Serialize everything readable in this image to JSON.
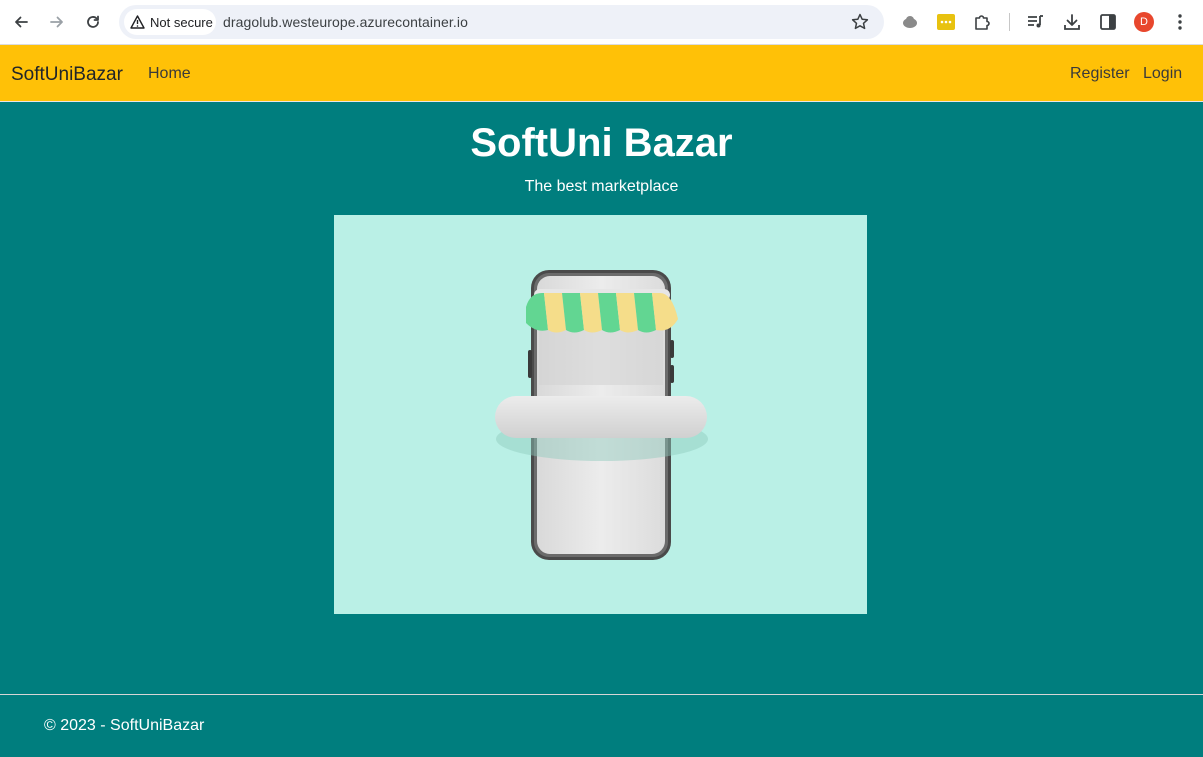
{
  "browser": {
    "security_label": "Not secure",
    "url": "dragolub.westeurope.azurecontainer.io",
    "profile_initial": "D",
    "icons": [
      "back-icon",
      "forward-icon",
      "reload-icon",
      "warning-icon",
      "star-icon",
      "cloud-icon",
      "password-icon",
      "extensions-icon",
      "media-icon",
      "download-icon",
      "side-panel-icon",
      "menu-icon"
    ],
    "colors": {
      "omnibox": "#eef1f8",
      "avatar": "#e8472d"
    }
  },
  "navbar": {
    "brand": "SoftUniBazar",
    "home": "Home",
    "register": "Register",
    "login": "Login",
    "color": "#ffc107"
  },
  "main": {
    "title": "SoftUni Bazar",
    "subtitle": "The best marketplace",
    "image_alt_icon": "phone-shop-illustration",
    "background": "#007e7e",
    "image_background": "#baf0e6"
  },
  "footer": {
    "text": "© 2023 - SoftUniBazar"
  }
}
